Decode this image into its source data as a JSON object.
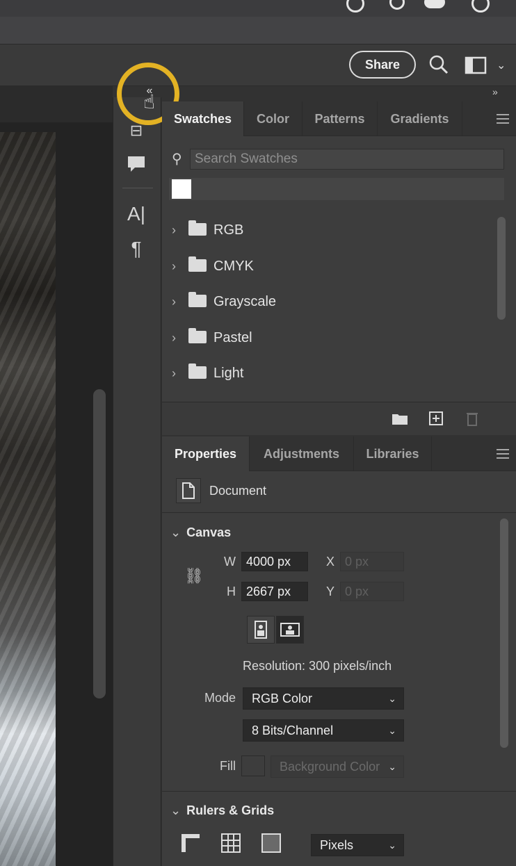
{
  "toolbar": {
    "share_label": "Share",
    "search_icon": "search-icon",
    "workspace_icon": "workspace-icon"
  },
  "collapse": {
    "collapse_arrows": "«",
    "expand_arrows": "»"
  },
  "swatches_panel": {
    "tabs": [
      {
        "label": "Swatches",
        "active": true
      },
      {
        "label": "Color",
        "active": false
      },
      {
        "label": "Patterns",
        "active": false
      },
      {
        "label": "Gradients",
        "active": false
      }
    ],
    "search_placeholder": "Search Swatches",
    "groups": [
      {
        "label": "RGB"
      },
      {
        "label": "CMYK"
      },
      {
        "label": "Grayscale"
      },
      {
        "label": "Pastel"
      },
      {
        "label": "Light"
      }
    ]
  },
  "properties_panel": {
    "tabs": [
      {
        "label": "Properties",
        "active": true
      },
      {
        "label": "Adjustments",
        "active": false
      },
      {
        "label": "Libraries",
        "active": false
      }
    ],
    "document_label": "Document",
    "canvas": {
      "title": "Canvas",
      "w_label": "W",
      "w_value": "4000 px",
      "h_label": "H",
      "h_value": "2667 px",
      "x_label": "X",
      "x_value": "0 px",
      "y_label": "Y",
      "y_value": "0 px",
      "resolution": "Resolution: 300 pixels/inch",
      "mode_label": "Mode",
      "mode_value": "RGB Color",
      "bits_value": "8 Bits/Channel",
      "fill_label": "Fill",
      "fill_value": "Background Color"
    },
    "rulers": {
      "title": "Rulers & Grids",
      "units_value": "Pixels"
    }
  },
  "colors": {
    "highlight_ring": "#e3b224",
    "panel_bg": "#3d3d3d"
  }
}
